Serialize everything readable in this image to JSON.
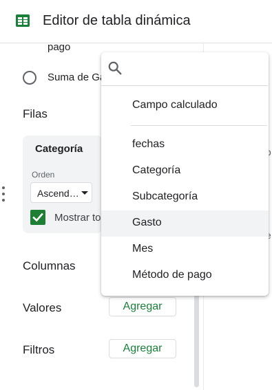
{
  "header": {
    "title": "Editor de tabla dinámica",
    "icon": "sheets-table-icon",
    "accent": "#188038"
  },
  "panel": {
    "value_item_partial": "pago",
    "suma_label": "Suma de Ga",
    "rows_section": {
      "label": "Filas",
      "card": {
        "title": "Categoría",
        "order_label": "Orden",
        "order_value": "Ascend…",
        "show_totals_label": "Mostrar to",
        "show_totals_checked": true
      }
    },
    "columns_label": "Columnas",
    "values_label": "Valores",
    "values_add": "Agregar",
    "filters_label": "Filtros",
    "filters_add": "Agregar"
  },
  "dropdown": {
    "search": {
      "value": "",
      "placeholder": ""
    },
    "calculated_field": "Campo calculado",
    "options": [
      "fechas",
      "Categoría",
      "Subcategoría",
      "Gasto",
      "Mes",
      "Método de pago"
    ],
    "highlighted": "Gasto"
  },
  "edge_glyphs": {
    "a": "o",
    "b": "e"
  }
}
